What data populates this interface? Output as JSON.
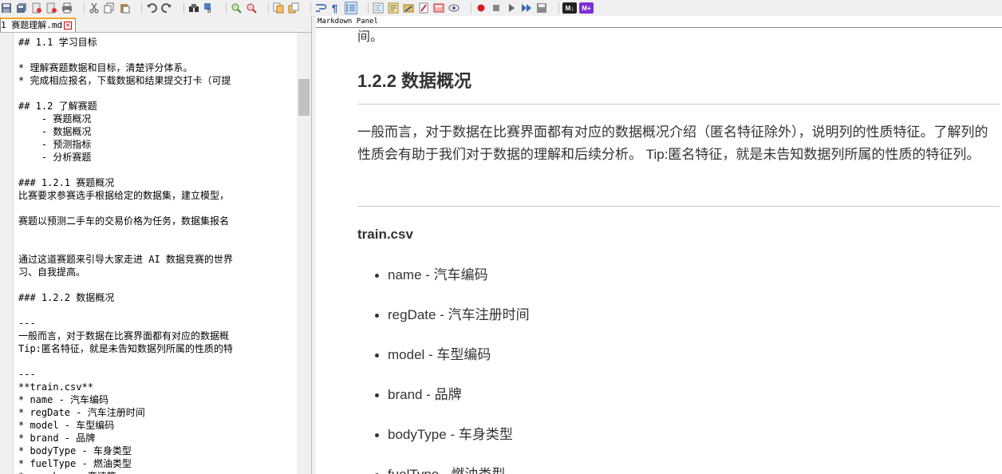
{
  "toolbar": {
    "badges": {
      "m1": "M↓",
      "m2": "M+"
    },
    "colors": {
      "accent_purple": "#7b2fd6",
      "badge_dark": "#222222"
    }
  },
  "editor": {
    "tab_label": "1 赛题理解.md",
    "lines": [
      "## 1.1 学习目标",
      "",
      "* 理解赛题数据和目标，清楚评分体系。",
      "* 完成相应报名，下载数据和结果提交打卡（可提",
      "",
      "## 1.2 了解赛题",
      "    - 赛题概况",
      "    - 数据概况",
      "    - 预测指标",
      "    - 分析赛题",
      "",
      "### 1.2.1 赛题概况",
      "比赛要求参赛选手根据给定的数据集，建立模型，",
      "",
      "赛题以预测二手车的交易价格为任务，数据集报名",
      "",
      "",
      "通过这道赛题来引导大家走进 AI 数据竞赛的世界",
      "习、自我提高。",
      "",
      "### 1.2.2 数据概况",
      "",
      "---",
      "一般而言，对于数据在比赛界面都有对应的数据概",
      "Tip:匿名特征，就是未告知数据列所属的性质的特",
      "",
      "---",
      "**train.csv**",
      "* name - 汽车编码",
      "* regDate - 汽车注册时间",
      "* model - 车型编码",
      "* brand - 品牌",
      "* bodyType - 车身类型",
      "* fuelType - 燃油类型",
      "* gearbox - 变速箱"
    ]
  },
  "panel": {
    "title": "Markdown Panel",
    "cut_text": "间。",
    "heading": "1.2.2 数据概况",
    "paragraph": "一般而言，对于数据在比赛界面都有对应的数据概况介绍（匿名特征除外），说明列的性质特征。了解列的性质会有助于我们对于数据的理解和后续分析。 Tip:匿名特征，就是未告知数据列所属的性质的特征列。",
    "file_label": "train.csv",
    "items": [
      "name - 汽车编码",
      "regDate - 汽车注册时间",
      "model - 车型编码",
      "brand - 品牌",
      "bodyType - 车身类型",
      "fuelType - 燃油类型"
    ]
  }
}
